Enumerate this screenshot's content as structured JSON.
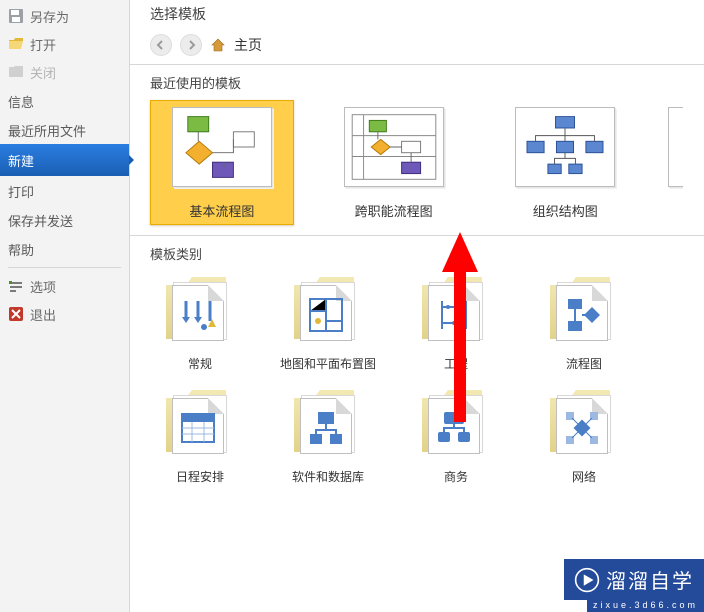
{
  "sidebar": {
    "items": [
      {
        "label": "另存为",
        "icon": "save-as"
      },
      {
        "label": "打开",
        "icon": "open"
      },
      {
        "label": "关闭",
        "icon": "close-doc",
        "disabled": true
      }
    ],
    "info": "信息",
    "recent": "最近所用文件",
    "new": "新建",
    "print": "打印",
    "saveSend": "保存并发送",
    "help": "帮助",
    "options": "选项",
    "exit": "退出"
  },
  "header": {
    "chooseTemplate": "选择模板",
    "home": "主页",
    "recentTemplates": "最近使用的模板",
    "templateCategories": "模板类别"
  },
  "recentTiles": [
    {
      "id": "basic-flowchart",
      "label": "基本流程图",
      "style": "flow-basic",
      "selected": true
    },
    {
      "id": "cross-func-flowchart",
      "label": "跨职能流程图",
      "style": "flow-swimlane"
    },
    {
      "id": "org-chart",
      "label": "组织结构图",
      "style": "org"
    }
  ],
  "categories": [
    {
      "id": "general",
      "label": "常规",
      "style": "general"
    },
    {
      "id": "maps-floorplans",
      "label": "地图和平面布置图",
      "style": "maps"
    },
    {
      "id": "engineering",
      "label": "工程",
      "style": "eng"
    },
    {
      "id": "flowchart",
      "label": "流程图",
      "style": "flowcat"
    },
    {
      "id": "schedule",
      "label": "日程安排",
      "style": "schedule"
    },
    {
      "id": "software-db",
      "label": "软件和数据库",
      "style": "swdb"
    },
    {
      "id": "business",
      "label": "商务",
      "style": "biz"
    },
    {
      "id": "network",
      "label": "网络",
      "style": "net"
    }
  ],
  "watermark": {
    "text": "溜溜自学",
    "sub": "zixue.3d66.com"
  }
}
